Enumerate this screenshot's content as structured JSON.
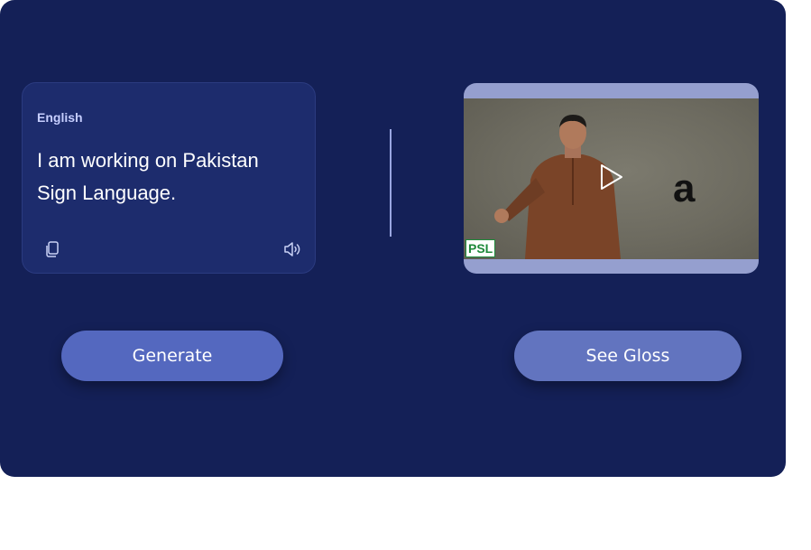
{
  "translator": {
    "source_language": "English",
    "input_text": "I am working on Pakistan Sign Language.",
    "icons": {
      "copy": "copy-icon",
      "speaker": "speaker-icon"
    }
  },
  "video": {
    "letter_shown": "a",
    "logo_text": "PSL",
    "play_icon": "play-icon"
  },
  "actions": {
    "generate_label": "Generate",
    "see_gloss_label": "See Gloss"
  },
  "colors": {
    "panel_bg": "#142057",
    "card_bg": "#1d2c6d",
    "button_bg": "#5468bf",
    "divider": "#9aa6e0"
  }
}
